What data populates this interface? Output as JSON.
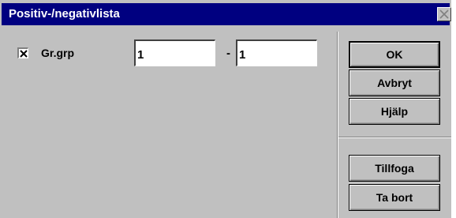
{
  "window": {
    "title": "Positiv-/negativlista"
  },
  "filter": {
    "checkbox_checked": true,
    "label": "Gr.grp",
    "from_value": "1",
    "separator": "-",
    "to_value": "1"
  },
  "buttons": {
    "ok": "OK",
    "cancel": "Avbryt",
    "help": "Hjälp",
    "add": "Tillfoga",
    "remove": "Ta bort"
  },
  "icons": {
    "close": "close-icon",
    "check": "checkmark-icon"
  },
  "colors": {
    "titlebar": "#000080",
    "face": "#c0c0c0"
  }
}
